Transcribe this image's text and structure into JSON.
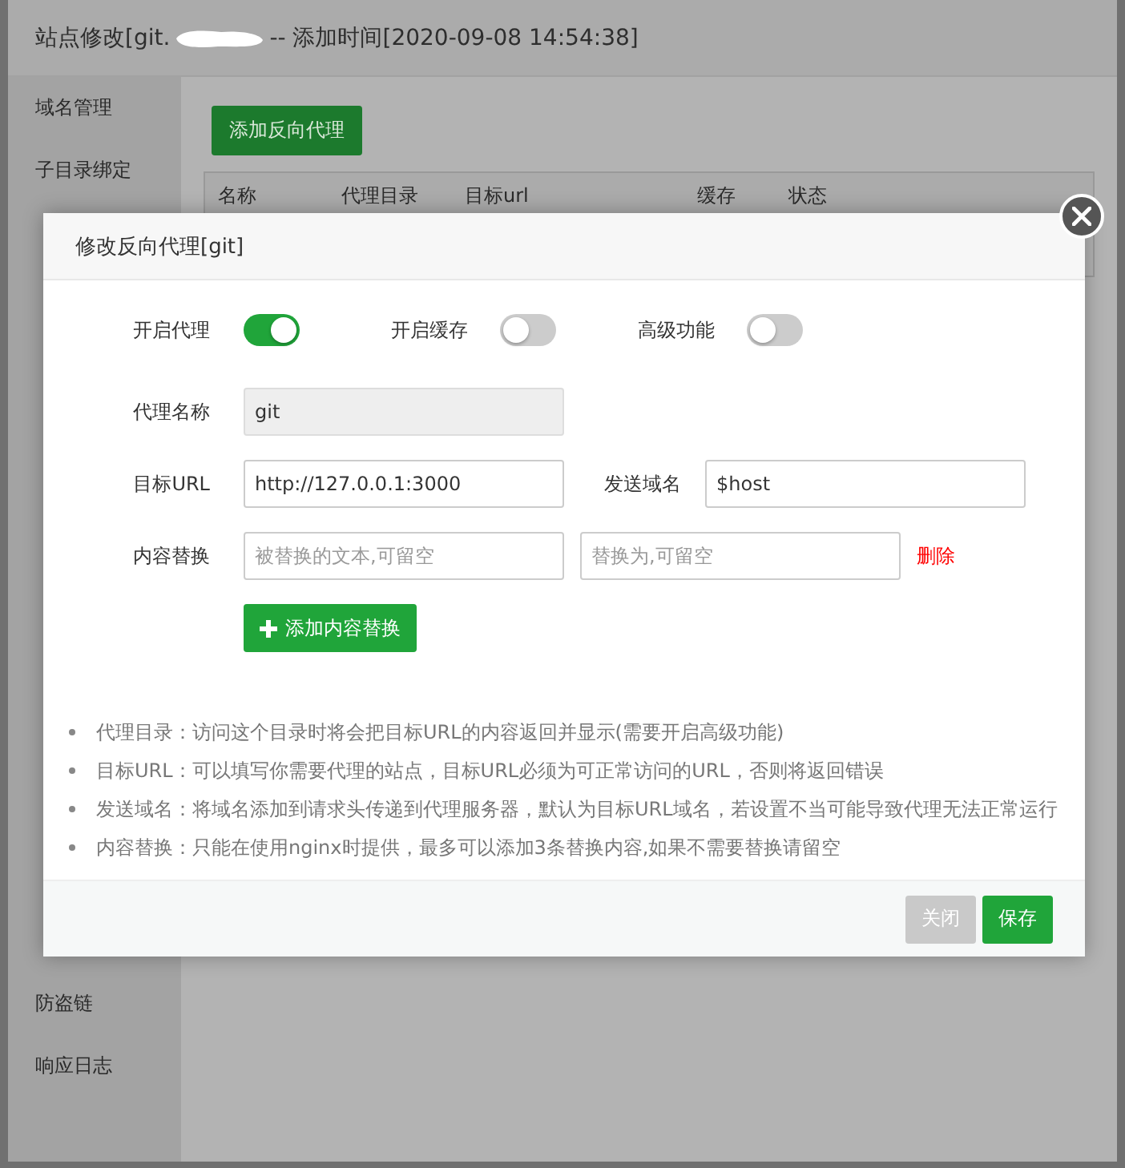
{
  "background_window": {
    "title_prefix": "站点修改[git.",
    "title_suffix": "-- 添加时间[2020-09-08 14:54:38]",
    "sidebar": {
      "top_items": [
        {
          "label": "域名管理"
        },
        {
          "label": "子目录绑定"
        }
      ],
      "bottom_items": [
        {
          "label": "防盗链"
        },
        {
          "label": "响应日志"
        }
      ]
    },
    "add_button": "添加反向代理",
    "table": {
      "columns": [
        "名称",
        "代理目录",
        "目标url",
        "缓存",
        "状态"
      ]
    }
  },
  "modal": {
    "title": "修改反向代理[git]",
    "toggles": [
      {
        "label": "开启代理",
        "on": true
      },
      {
        "label": "开启缓存",
        "on": false
      },
      {
        "label": "高级功能",
        "on": false
      }
    ],
    "proxy_name": {
      "label": "代理名称",
      "value": "git",
      "disabled": true
    },
    "target_url": {
      "label": "目标URL",
      "value": "http://127.0.0.1:3000"
    },
    "send_domain": {
      "label": "发送域名",
      "value": "$host"
    },
    "content_replace": {
      "label": "内容替换",
      "find_placeholder": "被替换的文本,可留空",
      "replace_placeholder": "替换为,可留空",
      "delete_link": "删除"
    },
    "add_replace_button": "添加内容替换",
    "notes": [
      "代理目录：访问这个目录时将会把目标URL的内容返回并显示(需要开启高级功能)",
      "目标URL：可以填写你需要代理的站点，目标URL必须为可正常访问的URL，否则将返回错误",
      "发送域名：将域名添加到请求头传递到代理服务器，默认为目标URL域名，若设置不当可能导致代理无法正常运行",
      "内容替换：只能在使用nginx时提供，最多可以添加3条替换内容,如果不需要替换请留空"
    ],
    "buttons": [
      {
        "label": "关闭",
        "kind": "close"
      },
      {
        "label": "保存",
        "kind": "save"
      }
    ]
  }
}
